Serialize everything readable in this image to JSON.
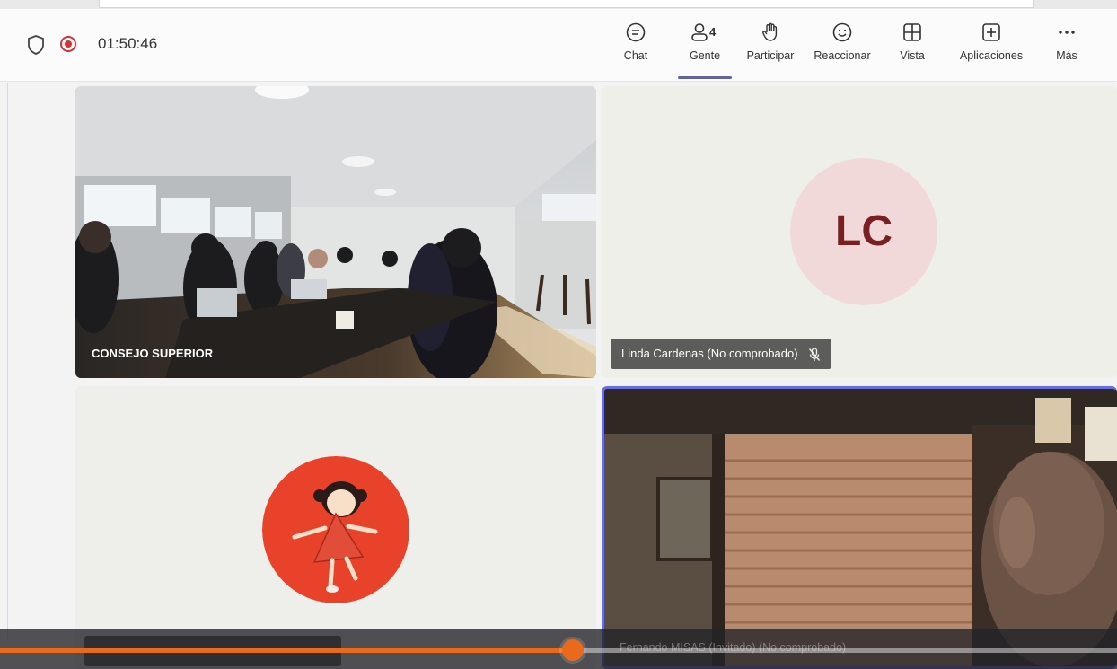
{
  "meeting": {
    "timer": "01:50:46",
    "recording": true
  },
  "toolbar": {
    "items": [
      {
        "label": "Chat",
        "icon": "chat-icon"
      },
      {
        "label": "Gente",
        "icon": "people-icon",
        "badge": "4",
        "active": true
      },
      {
        "label": "Participar",
        "icon": "raise-hand-icon"
      },
      {
        "label": "Reaccionar",
        "icon": "smiley-icon"
      },
      {
        "label": "Vista",
        "icon": "grid-view-icon"
      },
      {
        "label": "Aplicaciones",
        "icon": "plus-square-icon"
      },
      {
        "label": "Más",
        "icon": "more-dots-icon"
      }
    ]
  },
  "tiles": [
    {
      "name": "CONSEJO SUPERIOR",
      "type": "video"
    },
    {
      "name": "Linda Cardenas (No comprobado)",
      "initials": "LC",
      "type": "avatar",
      "muted": true
    },
    {
      "name": "",
      "type": "avatar-image",
      "muted": true
    },
    {
      "name": "",
      "type": "video",
      "active_speaker": true
    }
  ],
  "playback": {
    "progress": 0.513,
    "caption": "Fernando MISAS (Invitado) (No comprobado)"
  },
  "colors": {
    "accent": "#5b5fc7",
    "record": "#d13438",
    "progress": "#ea6a1c",
    "avatar_bg": "#f0d9d8",
    "avatar_text": "#7a1f22"
  }
}
